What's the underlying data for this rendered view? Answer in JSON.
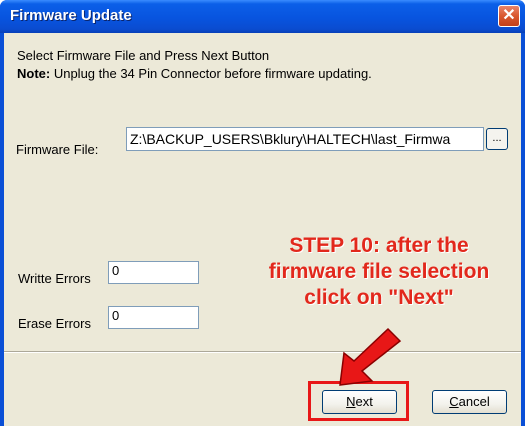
{
  "window": {
    "title": "Firmware Update",
    "close_glyph": "✕"
  },
  "instructions": {
    "line1": "Select Firmware File and Press Next Button",
    "note_label": "Note:",
    "note_text": " Unplug the 34 Pin Connector before firmware updating."
  },
  "firmware_file": {
    "label": "Firmware File:",
    "value": "Z:\\BACKUP_USERS\\Bklury\\HALTECH\\last_Firmwa",
    "browse_label": "..."
  },
  "errors": {
    "write_label": "Writte Errors",
    "write_value": "0",
    "erase_label": "Erase Errors",
    "erase_value": "0"
  },
  "buttons": {
    "next_u": "N",
    "next_rest": "ext",
    "cancel_u": "C",
    "cancel_rest": "ancel"
  },
  "annotation": {
    "line1": "STEP 10: after the",
    "line2": "firmware file selection",
    "line3": "click on \"Next\"",
    "color": "#e2281c"
  },
  "colors": {
    "titlebar": "#0854df",
    "client": "#ece9d8",
    "highlight_border": "#e81717"
  }
}
